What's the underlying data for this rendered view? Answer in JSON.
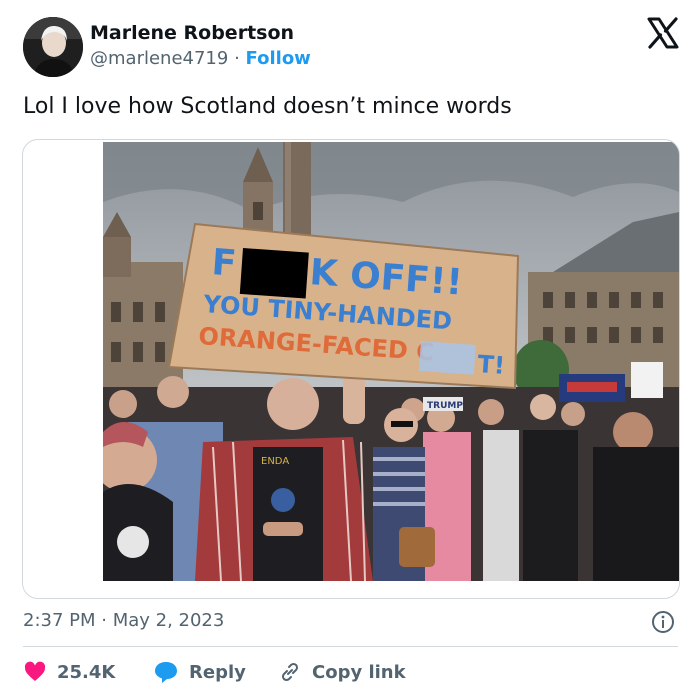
{
  "author": {
    "display_name": "Marlene Robertson",
    "handle": "@marlene4719",
    "separator": "·",
    "follow_label": "Follow"
  },
  "tweet": {
    "text": "Lol I love how Scotland doesn’t mince words",
    "timestamp": "2:37 PM · May 2, 2023"
  },
  "photo": {
    "sign_line1_a": "F",
    "sign_line1_b": "K OFF!!",
    "sign_line2": "YOU TINY-HANDED",
    "sign_line3_a": "ORANGE-FACED C",
    "sign_line3_b": "T!",
    "small_sign": "TRUMP",
    "shirt_text": "ENDA"
  },
  "actions": {
    "likes": "25.4K",
    "reply_label": "Reply",
    "copy_link_label": "Copy link"
  },
  "colors": {
    "like": "#f91880",
    "reply": "#1d9bf0",
    "link": "#1d9bf0",
    "muted": "#536471"
  },
  "icons": [
    "x-logo-icon",
    "info-icon",
    "heart-icon",
    "reply-bubble-icon",
    "link-icon"
  ]
}
